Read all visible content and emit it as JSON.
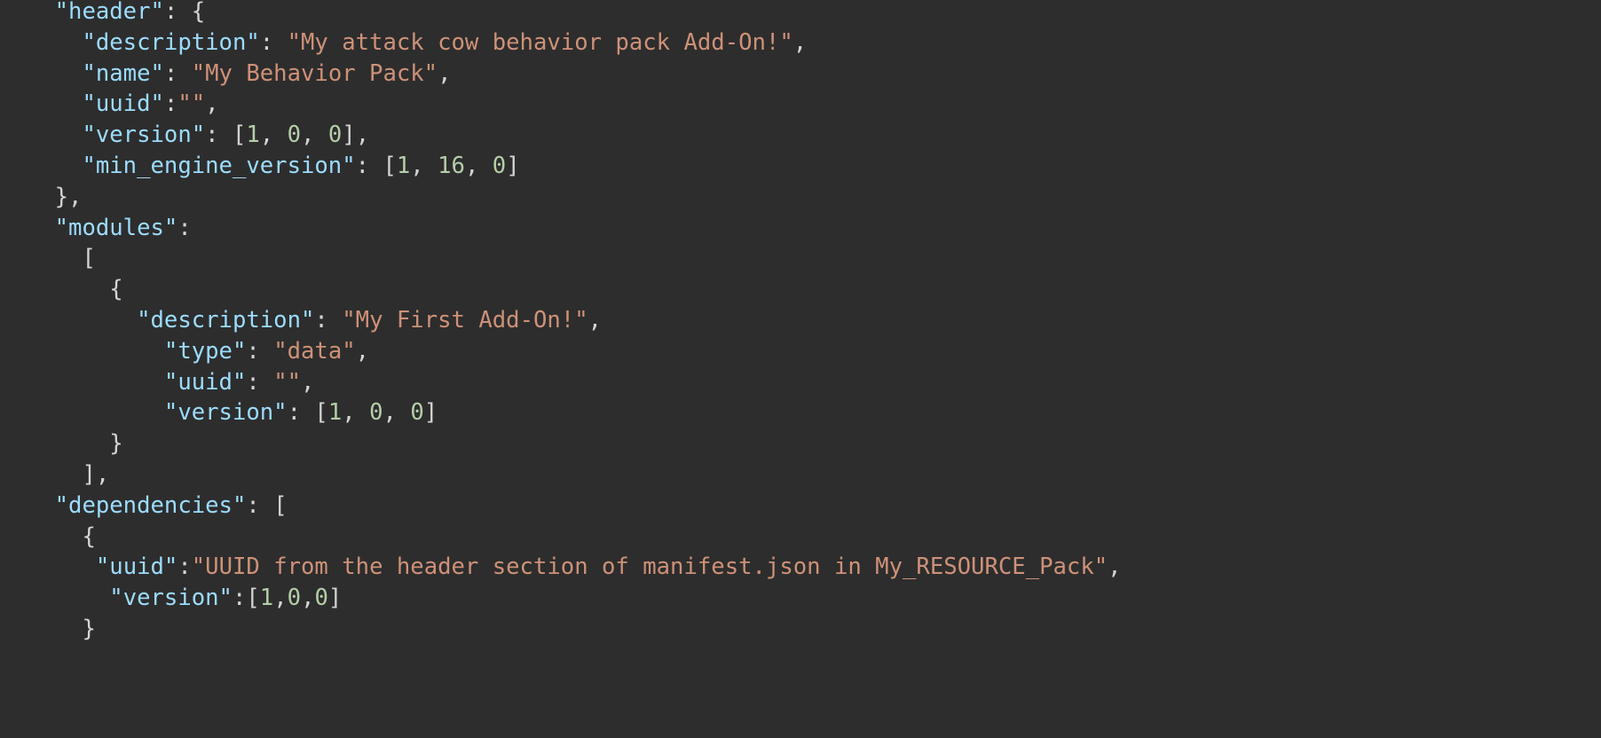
{
  "colors": {
    "background": "#2d2d2d",
    "key": "#9cdcfe",
    "string": "#ce9178",
    "number": "#b5cea8",
    "punctuation": "#d4d4d4"
  },
  "lines": [
    {
      "indent": "    ",
      "tokens": [
        {
          "t": "k",
          "v": "\"header\""
        },
        {
          "t": "p",
          "v": ": {"
        }
      ]
    },
    {
      "indent": "      ",
      "tokens": [
        {
          "t": "k",
          "v": "\"description\""
        },
        {
          "t": "p",
          "v": ": "
        },
        {
          "t": "s",
          "v": "\"My attack cow behavior pack Add-On!\""
        },
        {
          "t": "p",
          "v": ","
        }
      ]
    },
    {
      "indent": "      ",
      "tokens": [
        {
          "t": "k",
          "v": "\"name\""
        },
        {
          "t": "p",
          "v": ": "
        },
        {
          "t": "s",
          "v": "\"My Behavior Pack\""
        },
        {
          "t": "p",
          "v": ","
        }
      ]
    },
    {
      "indent": "      ",
      "tokens": [
        {
          "t": "k",
          "v": "\"uuid\""
        },
        {
          "t": "p",
          "v": ":"
        },
        {
          "t": "s",
          "v": "\"\""
        },
        {
          "t": "p",
          "v": ","
        }
      ]
    },
    {
      "indent": "      ",
      "tokens": [
        {
          "t": "k",
          "v": "\"version\""
        },
        {
          "t": "p",
          "v": ": ["
        },
        {
          "t": "n",
          "v": "1"
        },
        {
          "t": "p",
          "v": ", "
        },
        {
          "t": "n",
          "v": "0"
        },
        {
          "t": "p",
          "v": ", "
        },
        {
          "t": "n",
          "v": "0"
        },
        {
          "t": "p",
          "v": "],"
        }
      ]
    },
    {
      "indent": "      ",
      "tokens": [
        {
          "t": "k",
          "v": "\"min_engine_version\""
        },
        {
          "t": "p",
          "v": ": ["
        },
        {
          "t": "n",
          "v": "1"
        },
        {
          "t": "p",
          "v": ", "
        },
        {
          "t": "n",
          "v": "16"
        },
        {
          "t": "p",
          "v": ", "
        },
        {
          "t": "n",
          "v": "0"
        },
        {
          "t": "p",
          "v": "]"
        }
      ]
    },
    {
      "indent": "    ",
      "tokens": [
        {
          "t": "p",
          "v": "},"
        }
      ]
    },
    {
      "indent": "    ",
      "tokens": [
        {
          "t": "k",
          "v": "\"modules\""
        },
        {
          "t": "p",
          "v": ":"
        }
      ]
    },
    {
      "indent": "      ",
      "tokens": [
        {
          "t": "p",
          "v": "["
        }
      ]
    },
    {
      "indent": "        ",
      "tokens": [
        {
          "t": "p",
          "v": "{"
        }
      ]
    },
    {
      "indent": "          ",
      "tokens": [
        {
          "t": "k",
          "v": "\"description\""
        },
        {
          "t": "p",
          "v": ": "
        },
        {
          "t": "s",
          "v": "\"My First Add-On!\""
        },
        {
          "t": "p",
          "v": ","
        }
      ]
    },
    {
      "indent": "            ",
      "tokens": [
        {
          "t": "k",
          "v": "\"type\""
        },
        {
          "t": "p",
          "v": ": "
        },
        {
          "t": "s",
          "v": "\"data\""
        },
        {
          "t": "p",
          "v": ","
        }
      ]
    },
    {
      "indent": "            ",
      "tokens": [
        {
          "t": "k",
          "v": "\"uuid\""
        },
        {
          "t": "p",
          "v": ": "
        },
        {
          "t": "s",
          "v": "\"\""
        },
        {
          "t": "p",
          "v": ","
        }
      ]
    },
    {
      "indent": "            ",
      "tokens": [
        {
          "t": "k",
          "v": "\"version\""
        },
        {
          "t": "p",
          "v": ": ["
        },
        {
          "t": "n",
          "v": "1"
        },
        {
          "t": "p",
          "v": ", "
        },
        {
          "t": "n",
          "v": "0"
        },
        {
          "t": "p",
          "v": ", "
        },
        {
          "t": "n",
          "v": "0"
        },
        {
          "t": "p",
          "v": "]"
        }
      ]
    },
    {
      "indent": "        ",
      "tokens": [
        {
          "t": "p",
          "v": "}"
        }
      ]
    },
    {
      "indent": "      ",
      "tokens": [
        {
          "t": "p",
          "v": "],"
        }
      ]
    },
    {
      "indent": "    ",
      "tokens": [
        {
          "t": "k",
          "v": "\"dependencies\""
        },
        {
          "t": "p",
          "v": ": ["
        }
      ]
    },
    {
      "indent": "      ",
      "tokens": [
        {
          "t": "p",
          "v": "{"
        }
      ]
    },
    {
      "indent": "       ",
      "tokens": [
        {
          "t": "k",
          "v": "\"uuid\""
        },
        {
          "t": "p",
          "v": ":"
        },
        {
          "t": "s",
          "v": "\"UUID from the header section of manifest.json in My_RESOURCE_Pack\""
        },
        {
          "t": "p",
          "v": ","
        }
      ]
    },
    {
      "indent": "        ",
      "tokens": [
        {
          "t": "k",
          "v": "\"version\""
        },
        {
          "t": "p",
          "v": ":["
        },
        {
          "t": "n",
          "v": "1"
        },
        {
          "t": "p",
          "v": ","
        },
        {
          "t": "n",
          "v": "0"
        },
        {
          "t": "p",
          "v": ","
        },
        {
          "t": "n",
          "v": "0"
        },
        {
          "t": "p",
          "v": "]"
        }
      ]
    },
    {
      "indent": "      ",
      "tokens": [
        {
          "t": "p",
          "v": "}"
        }
      ]
    }
  ]
}
